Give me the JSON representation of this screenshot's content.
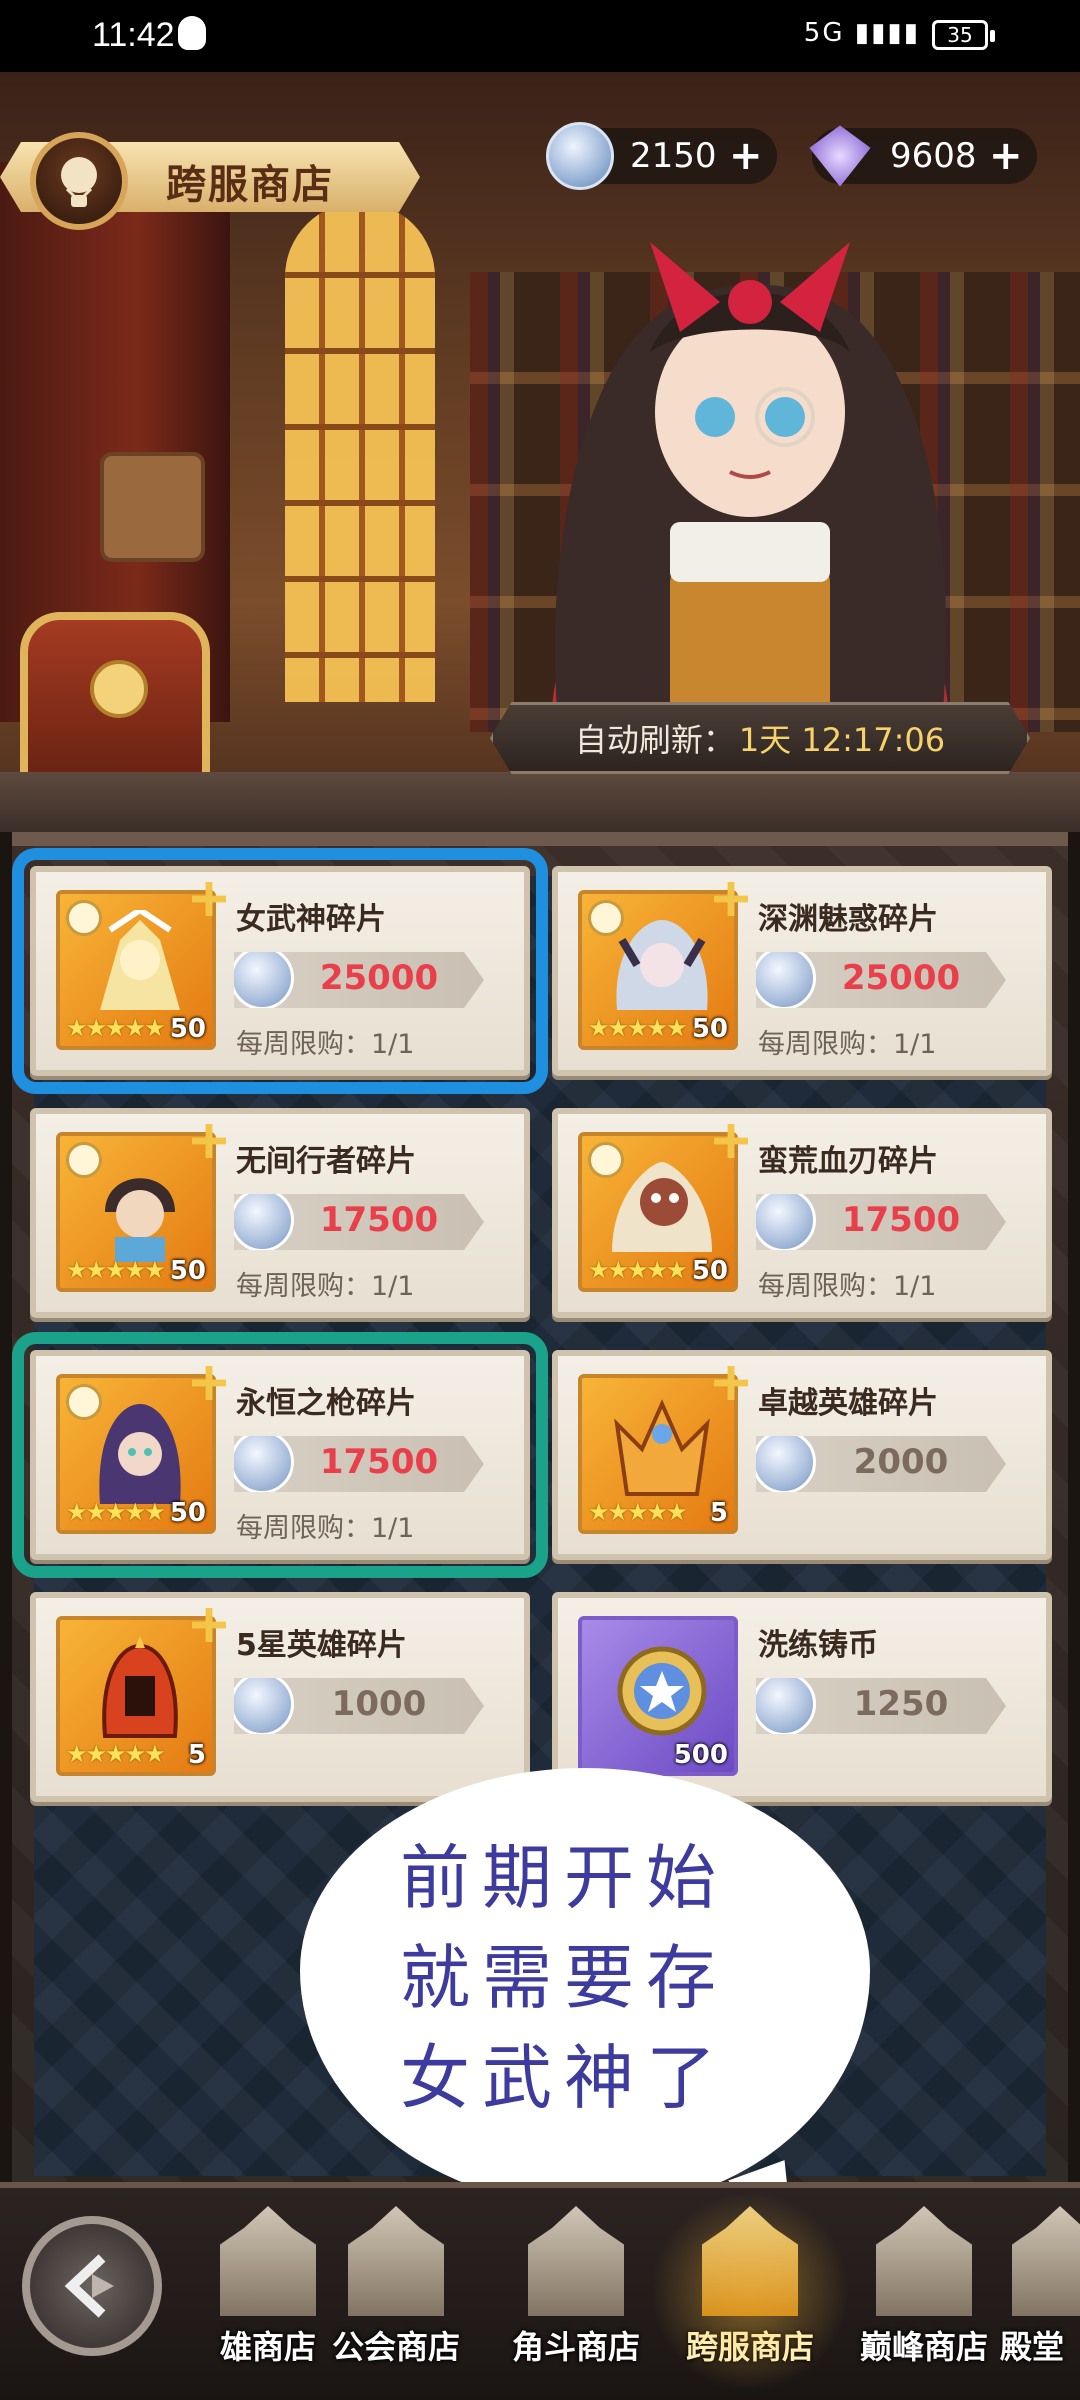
{
  "status_bar": {
    "time": "11:42",
    "signal": "5G",
    "battery": "35"
  },
  "header": {
    "title": "跨服商店"
  },
  "currency": [
    {
      "icon": "server-coin-icon",
      "amount": "2150"
    },
    {
      "icon": "diamond-icon",
      "amount": "9608"
    }
  ],
  "refresh": {
    "label": "自动刷新：",
    "value": "1天 12:17:06"
  },
  "items": [
    {
      "name": "女武神碎片",
      "price": "25000",
      "limit": "每周限购：1/1",
      "qty": "50",
      "stars": "★★★★★",
      "price_style": "red"
    },
    {
      "name": "深渊魅惑碎片",
      "price": "25000",
      "limit": "每周限购：1/1",
      "qty": "50",
      "stars": "★★★★★",
      "price_style": "red"
    },
    {
      "name": "无间行者碎片",
      "price": "17500",
      "limit": "每周限购：1/1",
      "qty": "50",
      "stars": "★★★★★",
      "price_style": "red"
    },
    {
      "name": "蛮荒血刃碎片",
      "price": "17500",
      "limit": "每周限购：1/1",
      "qty": "50",
      "stars": "★★★★★",
      "price_style": "red"
    },
    {
      "name": "永恒之枪碎片",
      "price": "17500",
      "limit": "每周限购：1/1",
      "qty": "50",
      "stars": "★★★★★",
      "price_style": "red"
    },
    {
      "name": "卓越英雄碎片",
      "price": "2000",
      "limit": "",
      "qty": "5",
      "stars": "★★★★★",
      "price_style": "plain"
    },
    {
      "name": "5星英雄碎片",
      "price": "1000",
      "limit": "",
      "qty": "5",
      "stars": "★★★★★",
      "price_style": "plain"
    },
    {
      "name": "洗练铸币",
      "price": "1250",
      "limit": "",
      "qty": "500",
      "stars": "",
      "price_style": "plain"
    }
  ],
  "bubble": {
    "text": "前期开始\n就需要存\n女武神了"
  },
  "nav": [
    {
      "label": "雄商店"
    },
    {
      "label": "公会商店"
    },
    {
      "label": "角斗商店"
    },
    {
      "label": "跨服商店"
    },
    {
      "label": "巅峰商店"
    },
    {
      "label": "殿堂"
    }
  ],
  "colors": {
    "selected_blue": "#1f8fe0",
    "selected_teal": "#1aa38a",
    "price_red": "#e83f4a"
  }
}
